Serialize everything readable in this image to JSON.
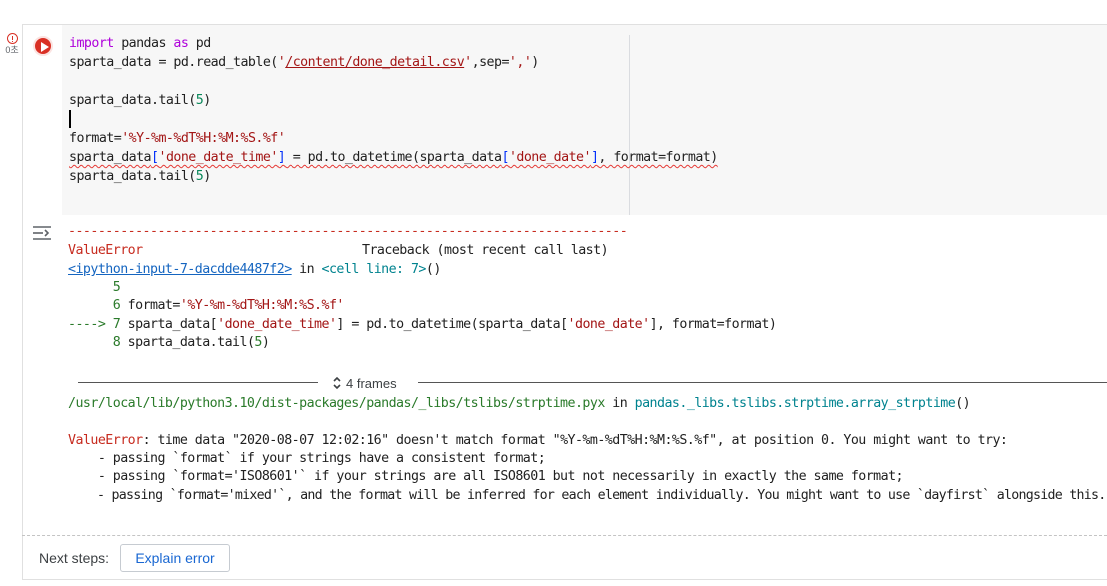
{
  "gutter": {
    "exec_time": "0초",
    "status": "error"
  },
  "code": {
    "line1": {
      "kw1": "import",
      "mid": " pandas ",
      "kw2": "as",
      "end": " pd"
    },
    "line2": {
      "pre": "sparta_data = pd.read_table(",
      "s": "'",
      "path": "/content/done_detail.csv",
      "s2": "'",
      "mid": ",sep=",
      "sep": "','",
      "end": ")"
    },
    "line3": {
      "pre": "sparta_data.tail(",
      "num": "5",
      "end": ")"
    },
    "line4": {
      "pre": "format=",
      "str": "'%Y-%m-%dT%H:%M:%S.%f'"
    },
    "line5": {
      "a": "sparta_data",
      "b": "[",
      "c": "'done_date_time'",
      "d": "]",
      "e": " = pd.to_datetime(sparta_data",
      "f": "[",
      "g": "'done_date'",
      "h": "]",
      "i": ", format=format)"
    },
    "line6": {
      "pre": "sparta_data.tail(",
      "num": "5",
      "end": ")"
    }
  },
  "output": {
    "dashes": "---------------------------------------------------------------------------",
    "error_name": "ValueError",
    "traceback_header": "Traceback (most recent call last)",
    "input_link": "<ipython-input-7-dacdde4487f2>",
    "in_word": " in ",
    "cell_line": "<cell line: 7>",
    "cell_line_end": "()",
    "tb5_num": "      5",
    "tb6_num": "      6",
    "tb6_a": " format=",
    "tb6_str": "'%Y-%m-%dT%H:%M:%S.%f'",
    "tb7_arrow": "----> 7",
    "tb7_a": " sparta_data[",
    "tb7_str1": "'done_date_time'",
    "tb7_b": "] = pd.to_datetime(sparta_data[",
    "tb7_str2": "'done_date'",
    "tb7_c": "], format=format)",
    "tb8_num": "      8",
    "tb8_a": " sparta_data.tail(",
    "tb8_n": "5",
    "tb8_end": ")",
    "frames_label": "4 frames",
    "strptime_path": "/usr/local/lib/python3.10/dist-packages/pandas/_libs/tslibs/strptime.pyx",
    "strptime_in": " in ",
    "strptime_func": "pandas._libs.tslibs.strptime.array_strptime",
    "strptime_end": "()",
    "msg_name": "ValueError",
    "msg_text": ": time data \"2020-08-07 12:02:16\" doesn't match format \"%Y-%m-%dT%H:%M:%S.%f\", at position 0. You might want to try:",
    "hint1": "    - passing `format` if your strings have a consistent format;",
    "hint2": "    - passing `format='ISO8601'` if your strings are all ISO8601 but not necessarily in exactly the same format;",
    "hint3": "    - passing `format='mixed'`, and the format will be inferred for each element individually. You might want to use `dayfirst` alongside this."
  },
  "footer": {
    "next_steps": "Next steps:",
    "explain_button": "Explain error"
  }
}
